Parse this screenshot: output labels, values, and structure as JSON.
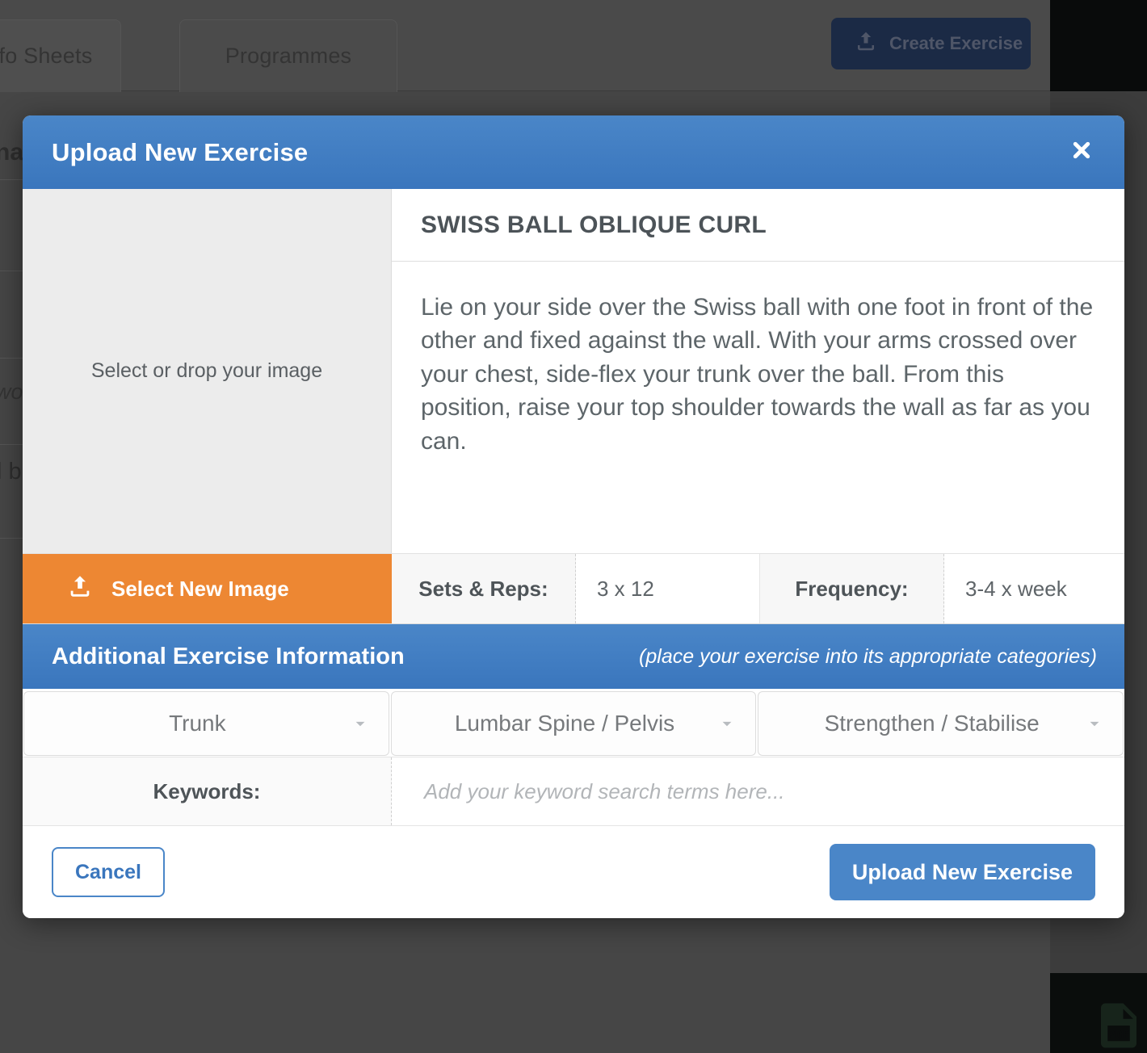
{
  "background": {
    "tabs": [
      {
        "label": "Info Sheets"
      },
      {
        "label": "Programmes"
      }
    ],
    "create_button": {
      "label": "Create Exercise",
      "icon": "upload-icon",
      "color": "#1b2a45"
    },
    "text_fragments": {
      "heading_fragment": "nal",
      "italic_fragment": "wo",
      "line_fragment": "l b"
    },
    "pdf_icon": "pdf-file-icon"
  },
  "modal": {
    "title": "Upload New Exercise",
    "close_icon": "close-icon",
    "header_color": "#3a76bd",
    "dropzone": {
      "label": "Select or drop your image"
    },
    "exercise": {
      "name": "SWISS BALL OBLIQUE CURL",
      "description": "Lie on your side over the Swiss ball with one foot in front of the other and fixed against the wall. With your arms crossed over your chest, side-flex your trunk over the ball. From this position, raise your top shoulder towards the wall as far as you can."
    },
    "meta_row": {
      "select_image_label": "Select New Image",
      "select_image_icon": "upload-icon",
      "select_image_color": "#ed8733",
      "sets_reps_label": "Sets & Reps:",
      "sets_reps_value": "3 x 12",
      "frequency_label": "Frequency:",
      "frequency_value": "3-4 x week"
    },
    "additional_section": {
      "title": "Additional Exercise Information",
      "hint": "(place your exercise into its appropriate categories)"
    },
    "category_selects": [
      {
        "value": "Trunk",
        "icon": "chevron-down-icon"
      },
      {
        "value": "Lumbar Spine / Pelvis",
        "icon": "chevron-down-icon"
      },
      {
        "value": "Strengthen / Stabilise",
        "icon": "chevron-down-icon"
      }
    ],
    "keywords": {
      "label": "Keywords:",
      "placeholder": "Add your keyword search terms here...",
      "value": ""
    },
    "footer": {
      "cancel_label": "Cancel",
      "submit_label": "Upload New Exercise"
    }
  }
}
